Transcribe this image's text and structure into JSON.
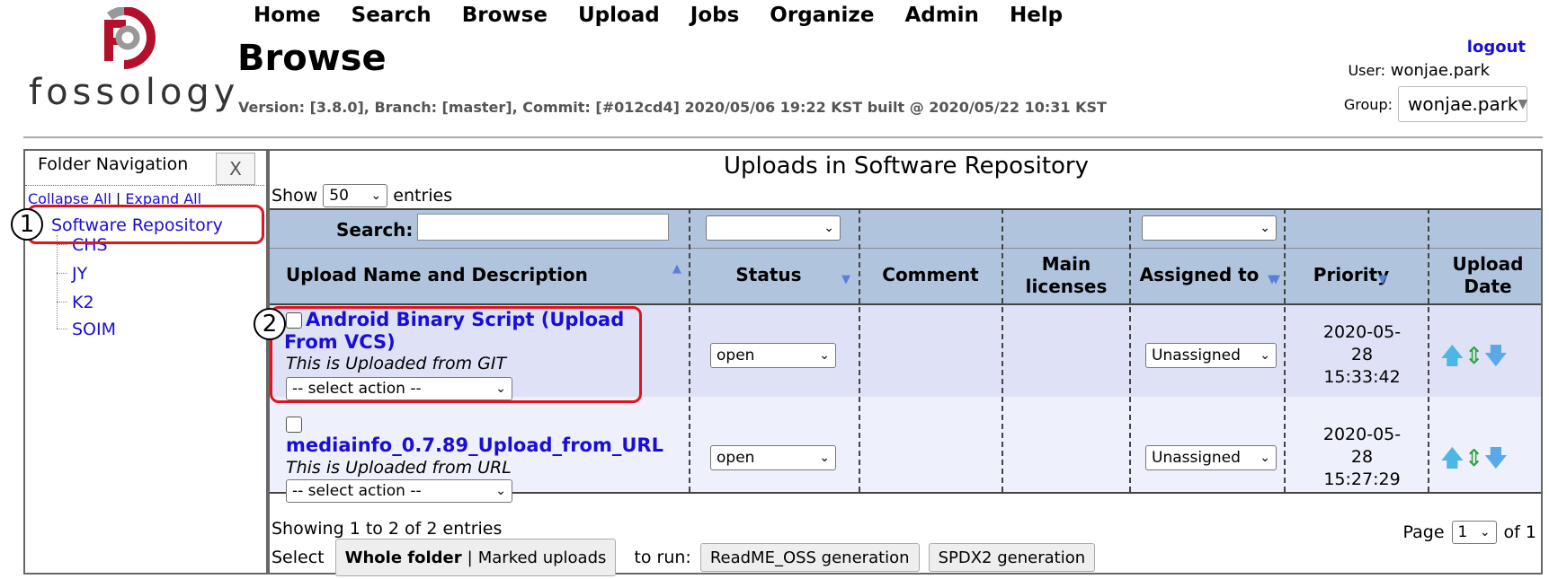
{
  "header": {
    "logo_text": "fossology",
    "nav": [
      "Home",
      "Search",
      "Browse",
      "Upload",
      "Jobs",
      "Organize",
      "Admin",
      "Help"
    ],
    "page_title": "Browse",
    "version": "Version: [3.8.0], Branch: [master], Commit: [#012cd4] 2020/05/06 19:22 KST built @ 2020/05/22 10:31 KST",
    "logout": "logout",
    "user_label": "User:",
    "user_name": "wonjae.park",
    "group_label": "Group:",
    "group_value": "wonjae.park"
  },
  "folder_nav": {
    "title": "Folder Navigation",
    "close": "X",
    "collapse_all": "Collapse All",
    "separator": "|",
    "expand_all": "Expand All",
    "root": "Software Repository",
    "children": [
      "CHS",
      "JY",
      "K2",
      "SOIM"
    ]
  },
  "uploads": {
    "title": "Uploads in Software Repository",
    "show_label": "Show",
    "show_value": "50",
    "entries_label": "entries",
    "search_label": "Search:",
    "search_value": "",
    "columns": {
      "name": "Upload Name and Description",
      "status": "Status",
      "comment": "Comment",
      "main_licenses_1": "Main",
      "main_licenses_2": "licenses",
      "assigned": "Assigned to",
      "upload_date_1": "Upload",
      "upload_date_2": "Date",
      "priority": "Priority"
    },
    "rows": [
      {
        "name": "Android Binary Script (Upload From VCS)",
        "description": "This is Uploaded from GIT",
        "action": "-- select action --",
        "status": "open",
        "assigned": "Unassigned",
        "date_1": "2020-05-",
        "date_2": "28",
        "date_3": "15:33:42"
      },
      {
        "name": "mediainfo_0.7.89_Upload_from_URL",
        "description": "This is Uploaded from URL",
        "action": "-- select action --",
        "status": "open",
        "assigned": "Unassigned",
        "date_1": "2020-05-",
        "date_2": "28",
        "date_3": "15:27:29"
      }
    ],
    "showing": "Showing 1 to 2 of 2 entries",
    "select_label": "Select",
    "whole_folder": "Whole folder",
    "pipe": "|",
    "marked_uploads": "Marked uploads",
    "to_run": "to run:",
    "readme_btn": "ReadME_OSS generation",
    "spdx_btn": "SPDX2 generation",
    "page_label": "Page",
    "page_value": "1",
    "of_label": "of 1"
  },
  "annotations": [
    "1",
    "2"
  ],
  "colors": {
    "header_row": "#b0c4de",
    "row_highlight": "#dfe2f7",
    "row_normal": "#eef0fb",
    "link": "#1a0dd6",
    "annotation": "#e0141e",
    "brand": "#b5102b"
  }
}
